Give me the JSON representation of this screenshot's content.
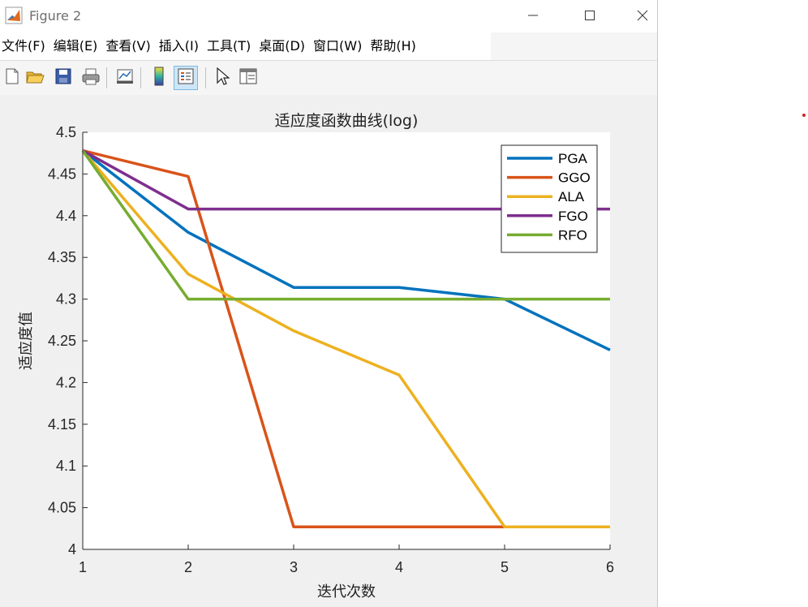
{
  "window": {
    "title": "Figure 2",
    "controls": {
      "minimize": "minimize-icon",
      "maximize": "maximize-icon",
      "close": "close-icon"
    }
  },
  "menu": [
    "文件(F)",
    "编辑(E)",
    "查看(V)",
    "插入(I)",
    "工具(T)",
    "桌面(D)",
    "窗口(W)",
    "帮助(H)"
  ],
  "toolbar": [
    {
      "icon": "new-figure-icon"
    },
    {
      "icon": "open-file-icon"
    },
    {
      "icon": "save-icon"
    },
    {
      "icon": "print-icon"
    },
    {
      "icon": "link-plot-icon"
    },
    {
      "icon": "insert-colorbar-icon"
    },
    {
      "icon": "insert-legend-icon",
      "active": true
    },
    {
      "icon": "pointer-icon"
    },
    {
      "icon": "property-inspector-icon"
    }
  ],
  "colors": {
    "PGA": "#0072BD",
    "GGO": "#D95319",
    "ALA": "#EDB120",
    "FGO": "#7E2F8E",
    "RFO": "#77AC30"
  },
  "chart_data": {
    "type": "line",
    "title": "适应度函数曲线(log)",
    "xlabel": "迭代次数",
    "ylabel": "适应度值",
    "xlim": [
      1,
      6
    ],
    "ylim": [
      4,
      4.5
    ],
    "xticks": [
      1,
      2,
      3,
      4,
      5,
      6
    ],
    "yticks": [
      4,
      4.05,
      4.1,
      4.15,
      4.2,
      4.25,
      4.3,
      4.35,
      4.4,
      4.45,
      4.5
    ],
    "ytick_labels": [
      "4",
      "4.05",
      "4.1",
      "4.15",
      "4.2",
      "4.25",
      "4.3",
      "4.35",
      "4.4",
      "4.45",
      "4.5"
    ],
    "grid": false,
    "legend_position": "top-right",
    "x": [
      1,
      2,
      3,
      4,
      5,
      6
    ],
    "series": [
      {
        "name": "PGA",
        "values": [
          4.478,
          4.38,
          4.314,
          4.314,
          4.3,
          4.239
        ]
      },
      {
        "name": "GGO",
        "values": [
          4.478,
          4.447,
          4.027,
          4.027,
          4.027,
          4.027
        ]
      },
      {
        "name": "ALA",
        "values": [
          4.478,
          4.33,
          4.262,
          4.209,
          4.027,
          4.027
        ]
      },
      {
        "name": "FGO",
        "values": [
          4.478,
          4.408,
          4.408,
          4.408,
          4.408,
          4.408
        ]
      },
      {
        "name": "RFO",
        "values": [
          4.478,
          4.3,
          4.3,
          4.3,
          4.3,
          4.3
        ]
      }
    ]
  }
}
